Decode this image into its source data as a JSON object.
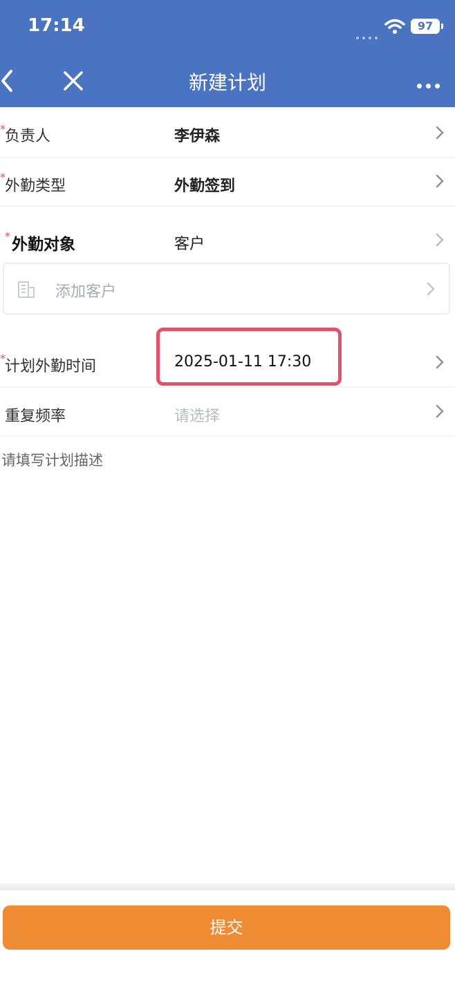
{
  "status_bar": {
    "time": "17:14",
    "battery": "97"
  },
  "nav": {
    "title": "新建计划"
  },
  "form": {
    "owner": {
      "required": "*",
      "label": "负责人",
      "value": "李伊森"
    },
    "visit_type": {
      "required": "*",
      "label": "外勤类型",
      "value": "外勤签到"
    },
    "visit_target": {
      "required": "*",
      "label": "外勤对象",
      "value": "客户"
    },
    "add_customer": {
      "placeholder": "添加客户"
    },
    "planned_time": {
      "required": "*",
      "label": "计划外勤时间",
      "value": "2025-01-11 17:30"
    },
    "repeat": {
      "label": "重复频率",
      "placeholder": "请选择"
    },
    "description": {
      "placeholder": "请填写计划描述"
    }
  },
  "submit_label": "提交",
  "colors": {
    "header": "#4a74c2",
    "submit": "#ef8c33",
    "highlight": "#e2526a",
    "required": "#e34d59"
  }
}
